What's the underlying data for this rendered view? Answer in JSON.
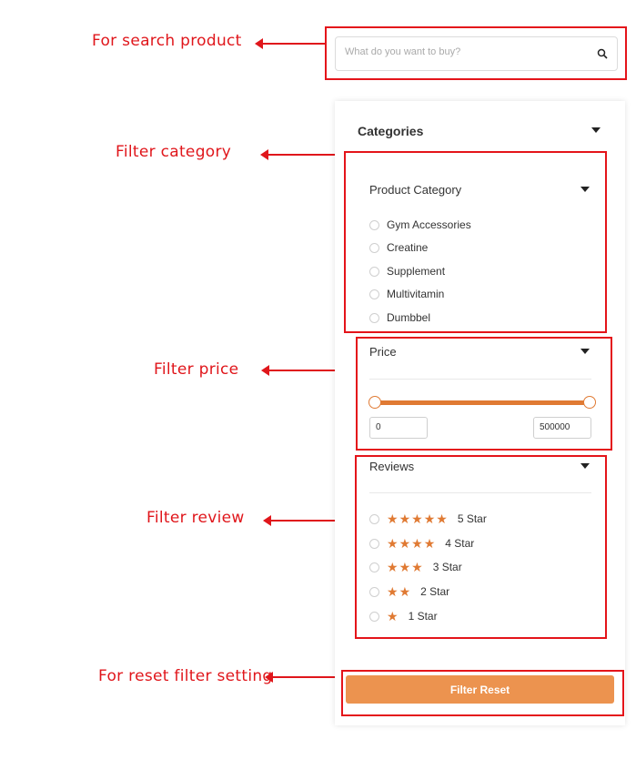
{
  "annotations": {
    "search": "For search product",
    "category": "Filter category",
    "price": "Filter price",
    "review": "Filter review",
    "reset": "For reset filter setting"
  },
  "search": {
    "placeholder": "What do you want to buy?",
    "value": "",
    "icon": "search-icon"
  },
  "categories": {
    "title": "Categories",
    "product_category": {
      "title": "Product Category",
      "options": [
        "Gym Accessories",
        "Creatine",
        "Supplement",
        "Multivitamin",
        "Dumbbel"
      ]
    }
  },
  "price": {
    "title": "Price",
    "min": "0",
    "max": "500000",
    "range_fraction": [
      0,
      1
    ]
  },
  "reviews": {
    "title": "Reviews",
    "options": [
      {
        "stars": 5,
        "label": "5 Star"
      },
      {
        "stars": 4,
        "label": "4 Star"
      },
      {
        "stars": 3,
        "label": "3 Star"
      },
      {
        "stars": 2,
        "label": "2 Star"
      },
      {
        "stars": 1,
        "label": "1 Star"
      }
    ]
  },
  "reset_button": {
    "label": "Filter Reset"
  },
  "colors": {
    "accent": "#e07a33",
    "button": "#ec934f",
    "annotation": "#e0161b"
  }
}
